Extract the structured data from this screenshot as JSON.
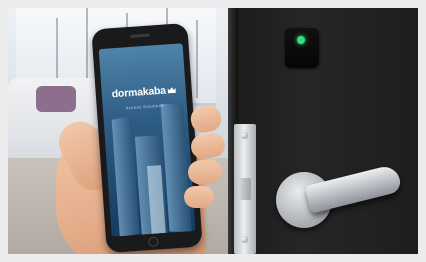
{
  "photo": {
    "phone_app": {
      "brand": "dormakaba",
      "brand_icon": "crown-icon",
      "tagline": "Access Solutions"
    },
    "door": {
      "reader_led_color": "#34e07a",
      "finish_color": "#1e1e1e",
      "hardware_color": "#b5b9be"
    },
    "screen_color": "#2d5c84"
  }
}
